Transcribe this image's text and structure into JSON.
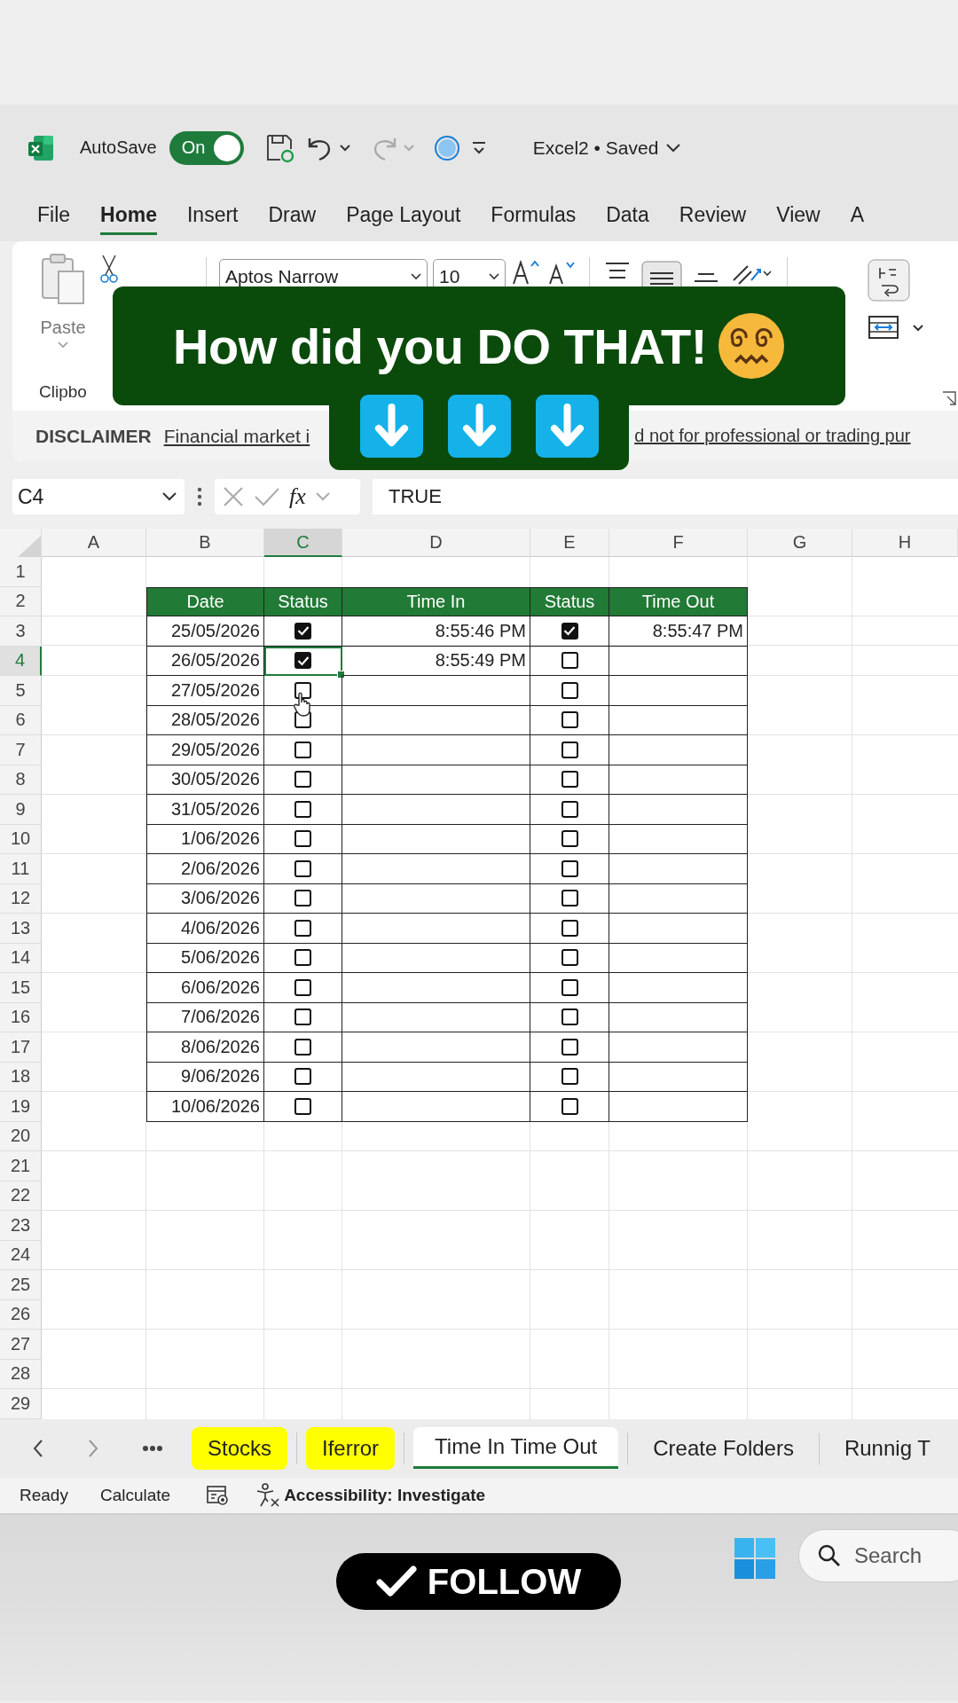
{
  "title_bar": {
    "autosave_label": "AutoSave",
    "autosave_toggle": {
      "label": "On",
      "on": true
    },
    "document_title": "Excel2 • Saved"
  },
  "ribbon_tabs": [
    {
      "label": "File",
      "selected": false
    },
    {
      "label": "Home",
      "selected": true
    },
    {
      "label": "Insert",
      "selected": false
    },
    {
      "label": "Draw",
      "selected": false
    },
    {
      "label": "Page Layout",
      "selected": false
    },
    {
      "label": "Formulas",
      "selected": false
    },
    {
      "label": "Data",
      "selected": false
    },
    {
      "label": "Review",
      "selected": false
    },
    {
      "label": "View",
      "selected": false
    },
    {
      "label": "A",
      "selected": false
    }
  ],
  "ribbon": {
    "paste_label": "Paste",
    "clipboard_group_label": "Clipbo",
    "font_name": "Aptos Narrow",
    "font_size": "10"
  },
  "disclaimer": {
    "label": "DISCLAIMER",
    "text_visible_start": "Financial market i",
    "text_visible_end": "d not for professional or trading pur"
  },
  "formula_bar": {
    "name_box": "C4",
    "function_label": "fx",
    "formula": "TRUE"
  },
  "sheet": {
    "columns": [
      {
        "label": "A",
        "selected": false
      },
      {
        "label": "B",
        "selected": false
      },
      {
        "label": "C",
        "selected": true
      },
      {
        "label": "D",
        "selected": false
      },
      {
        "label": "E",
        "selected": false
      },
      {
        "label": "F",
        "selected": false
      },
      {
        "label": "G",
        "selected": false
      },
      {
        "label": "H",
        "selected": false
      }
    ],
    "row_numbers": [
      {
        "label": "1",
        "selected": false
      },
      {
        "label": "2",
        "selected": false
      },
      {
        "label": "3",
        "selected": false
      },
      {
        "label": "4",
        "selected": true
      },
      {
        "label": "5",
        "selected": false
      },
      {
        "label": "6",
        "selected": false
      },
      {
        "label": "7",
        "selected": false
      },
      {
        "label": "8",
        "selected": false
      },
      {
        "label": "9",
        "selected": false
      },
      {
        "label": "10",
        "selected": false
      },
      {
        "label": "11",
        "selected": false
      },
      {
        "label": "12",
        "selected": false
      },
      {
        "label": "13",
        "selected": false
      },
      {
        "label": "14",
        "selected": false
      },
      {
        "label": "15",
        "selected": false
      },
      {
        "label": "16",
        "selected": false
      },
      {
        "label": "17",
        "selected": false
      },
      {
        "label": "18",
        "selected": false
      },
      {
        "label": "19",
        "selected": false
      },
      {
        "label": "20",
        "selected": false
      },
      {
        "label": "21",
        "selected": false
      },
      {
        "label": "22",
        "selected": false
      },
      {
        "label": "23",
        "selected": false
      },
      {
        "label": "24",
        "selected": false
      },
      {
        "label": "25",
        "selected": false
      },
      {
        "label": "26",
        "selected": false
      },
      {
        "label": "27",
        "selected": false
      },
      {
        "label": "28",
        "selected": false
      },
      {
        "label": "29",
        "selected": false
      }
    ],
    "table": {
      "headers": [
        "Date",
        "Status",
        "Time In",
        "Status",
        "Time Out"
      ],
      "rows": [
        {
          "date": "25/05/2026",
          "status_in": true,
          "time_in": "8:55:46 PM",
          "status_out": true,
          "time_out": "8:55:47 PM",
          "selected": false
        },
        {
          "date": "26/05/2026",
          "status_in": true,
          "time_in": "8:55:49 PM",
          "status_out": false,
          "selected": true
        },
        {
          "date": "27/05/2026",
          "status_in": false,
          "status_out": false,
          "selected": false
        },
        {
          "date": "28/05/2026",
          "status_in": false,
          "status_out": false,
          "selected": false
        },
        {
          "date": "29/05/2026",
          "status_in": false,
          "status_out": false,
          "selected": false
        },
        {
          "date": "30/05/2026",
          "status_in": false,
          "status_out": false,
          "selected": false
        },
        {
          "date": "31/05/2026",
          "status_in": false,
          "status_out": false,
          "selected": false
        },
        {
          "date": "1/06/2026",
          "status_in": false,
          "status_out": false,
          "selected": false
        },
        {
          "date": "2/06/2026",
          "status_in": false,
          "status_out": false,
          "selected": false
        },
        {
          "date": "3/06/2026",
          "status_in": false,
          "status_out": false,
          "selected": false
        },
        {
          "date": "4/06/2026",
          "status_in": false,
          "status_out": false,
          "selected": false
        },
        {
          "date": "5/06/2026",
          "status_in": false,
          "status_out": false,
          "selected": false
        },
        {
          "date": "6/06/2026",
          "status_in": false,
          "status_out": false,
          "selected": false
        },
        {
          "date": "7/06/2026",
          "status_in": false,
          "status_out": false,
          "selected": false
        },
        {
          "date": "8/06/2026",
          "status_in": false,
          "status_out": false,
          "selected": false
        },
        {
          "date": "9/06/2026",
          "status_in": false,
          "status_out": false,
          "selected": false
        },
        {
          "date": "10/06/2026",
          "status_in": false,
          "status_out": false,
          "selected": false
        }
      ]
    }
  },
  "sheet_tabs": [
    {
      "label": "Stocks",
      "selected": false,
      "color": "#ffff00"
    },
    {
      "label": "Iferror",
      "selected": false,
      "color": "#ffff00"
    },
    {
      "label": "Time In Time Out",
      "selected": true
    },
    {
      "label": "Create Folders",
      "selected": false
    },
    {
      "label": "Runnig T",
      "selected": false
    }
  ],
  "status_bar": {
    "ready": "Ready",
    "calculate": "Calculate",
    "accessibility": "Accessibility: Investigate"
  },
  "taskbar": {
    "search_label": "Search"
  },
  "overlay": {
    "headline": "How did you DO THAT!",
    "follow_label": "FOLLOW"
  }
}
